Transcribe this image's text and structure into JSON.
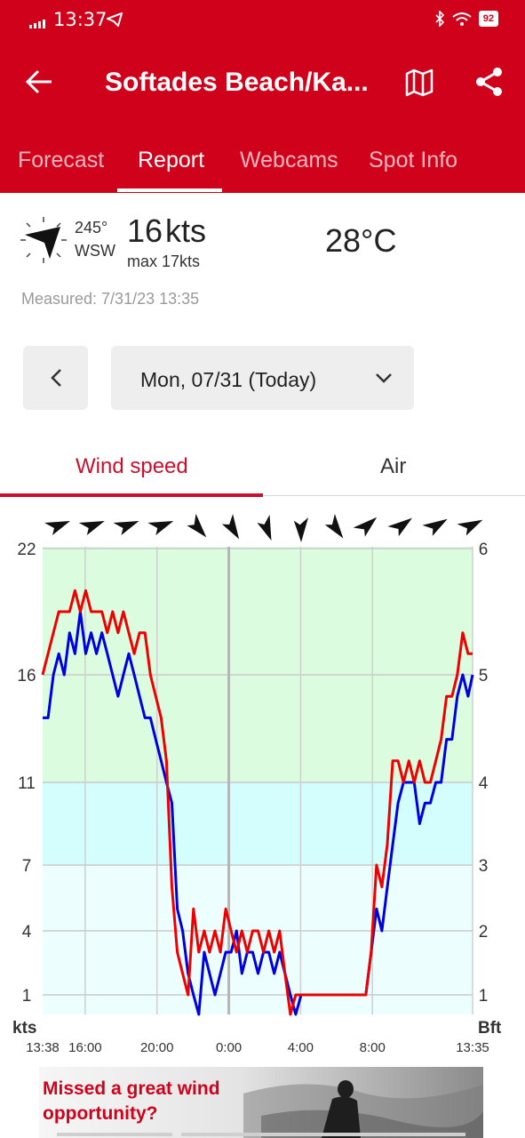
{
  "status_bar": {
    "time": "13:37",
    "battery": "92",
    "icons": [
      "signal-icon",
      "telegram-icon",
      "bluetooth-icon",
      "wifi-icon",
      "battery-icon"
    ]
  },
  "header": {
    "title": "Softades Beach/Ka...",
    "tabs": [
      {
        "label": "Forecast",
        "active": false
      },
      {
        "label": "Report",
        "active": true
      },
      {
        "label": "Webcams",
        "active": false
      },
      {
        "label": "Spot Info",
        "active": false
      }
    ],
    "icons": [
      "back-arrow-icon",
      "map-icon",
      "share-icon"
    ]
  },
  "current": {
    "direction_deg": "245°",
    "direction_name": "WSW",
    "speed_value": "16",
    "speed_unit": "kts",
    "max_label": "max 17kts",
    "temperature": "28°C",
    "measured": "Measured: 7/31/23 13:35"
  },
  "date_nav": {
    "selected": "Mon, 07/31 (Today)"
  },
  "subtabs": [
    {
      "label": "Wind speed",
      "active": true
    },
    {
      "label": "Air",
      "active": false
    }
  ],
  "colors": {
    "brand": "#d0021b",
    "wind_avg": "#0000dd",
    "wind_gust": "#ee0000",
    "zone_green": "#dcfce0",
    "zone_cyan": "#d4fdfd",
    "zone_pale": "#ecfefe"
  },
  "chart_data": {
    "type": "line",
    "y_left_label": "kts",
    "y_right_label": "Bft",
    "y_left_ticks": [
      "22",
      "16",
      "11",
      "7",
      "4",
      "1"
    ],
    "y_right_ticks": [
      "6",
      "5",
      "4",
      "3",
      "2",
      "1"
    ],
    "x_ticks": [
      "13:38",
      "16:00",
      "20:00",
      "0:00",
      "4:00",
      "8:00",
      "13:35"
    ],
    "x_tick_hours": [
      0,
      2.37,
      6.37,
      10.37,
      14.37,
      18.37,
      23.95
    ],
    "ylim": [
      0,
      22
    ],
    "grid": true,
    "direction_arrows_deg": [
      240,
      240,
      240,
      240,
      310,
      320,
      330,
      350,
      315,
      220,
      225,
      230,
      235
    ],
    "series": [
      {
        "color": "#0000dd",
        "x": [
          0,
          0.3,
          0.6,
          0.9,
          1.2,
          1.5,
          1.8,
          2.1,
          2.4,
          2.7,
          3.0,
          3.3,
          3.6,
          3.9,
          4.2,
          4.5,
          4.8,
          5.1,
          5.4,
          5.7,
          6.0,
          6.3,
          6.6,
          6.9,
          7.2,
          7.5,
          7.8,
          8.1,
          8.4,
          8.7,
          9.0,
          9.3,
          9.6,
          9.9,
          10.2,
          10.5,
          10.8,
          11.1,
          11.4,
          11.7,
          12.0,
          12.3,
          12.6,
          12.9,
          13.2,
          13.5,
          13.8,
          14.1,
          14.4,
          14.7,
          15.0,
          15.3,
          15.6,
          15.9,
          16.2,
          16.5,
          16.8,
          17.1,
          17.4,
          17.7,
          18.0,
          18.3,
          18.6,
          18.9,
          19.2,
          19.5,
          19.8,
          20.1,
          20.4,
          20.7,
          21.0,
          21.3,
          21.6,
          21.9,
          22.2,
          22.5,
          22.8,
          23.1,
          23.4,
          23.7,
          23.95
        ],
        "values": [
          14,
          14,
          16,
          17,
          16,
          18,
          17,
          19,
          17,
          18,
          17,
          18,
          17,
          16,
          15,
          16,
          17,
          16,
          15,
          14,
          14,
          13,
          12,
          11,
          10,
          5,
          4,
          2,
          1,
          0,
          3,
          2,
          1,
          2,
          3,
          3,
          4,
          2,
          3,
          3,
          2,
          3,
          3,
          2,
          3,
          2,
          1,
          0,
          1,
          1,
          1,
          1,
          1,
          1,
          1,
          1,
          1,
          1,
          1,
          1,
          1,
          3,
          5,
          4,
          6,
          8,
          10,
          11,
          11,
          11,
          9,
          10,
          10,
          11,
          11,
          13,
          13,
          15,
          16,
          15,
          16
        ]
      },
      {
        "color": "#ee0000",
        "x": [
          0,
          0.3,
          0.6,
          0.9,
          1.2,
          1.5,
          1.8,
          2.1,
          2.4,
          2.7,
          3.0,
          3.3,
          3.6,
          3.9,
          4.2,
          4.5,
          4.8,
          5.1,
          5.4,
          5.7,
          6.0,
          6.3,
          6.6,
          6.9,
          7.2,
          7.5,
          7.8,
          8.1,
          8.4,
          8.7,
          9.0,
          9.3,
          9.6,
          9.9,
          10.2,
          10.5,
          10.8,
          11.1,
          11.4,
          11.7,
          12.0,
          12.3,
          12.6,
          12.9,
          13.2,
          13.5,
          13.8,
          14.1,
          14.4,
          14.7,
          15.0,
          15.3,
          15.6,
          15.9,
          16.2,
          16.5,
          16.8,
          17.1,
          17.4,
          17.7,
          18.0,
          18.3,
          18.6,
          18.9,
          19.2,
          19.5,
          19.8,
          20.1,
          20.4,
          20.7,
          21.0,
          21.3,
          21.6,
          21.9,
          22.2,
          22.5,
          22.8,
          23.1,
          23.4,
          23.7,
          23.95
        ],
        "values": [
          16,
          17,
          18,
          19,
          19,
          19,
          20,
          19,
          20,
          19,
          19,
          19,
          18,
          19,
          18,
          19,
          18,
          17,
          18,
          18,
          16,
          15,
          14,
          12,
          6,
          3,
          2,
          1,
          5,
          3,
          4,
          3,
          4,
          3,
          5,
          4,
          3,
          4,
          3,
          4,
          4,
          3,
          4,
          3,
          4,
          2,
          0,
          1,
          1,
          1,
          1,
          1,
          1,
          1,
          1,
          1,
          1,
          1,
          1,
          1,
          1,
          3,
          7,
          6,
          8,
          12,
          12,
          11,
          12,
          11,
          12,
          11,
          11,
          12,
          13,
          15,
          15,
          16,
          18,
          17,
          17
        ]
      }
    ]
  },
  "banner": {
    "text": "Missed a great wind opportunity?"
  }
}
